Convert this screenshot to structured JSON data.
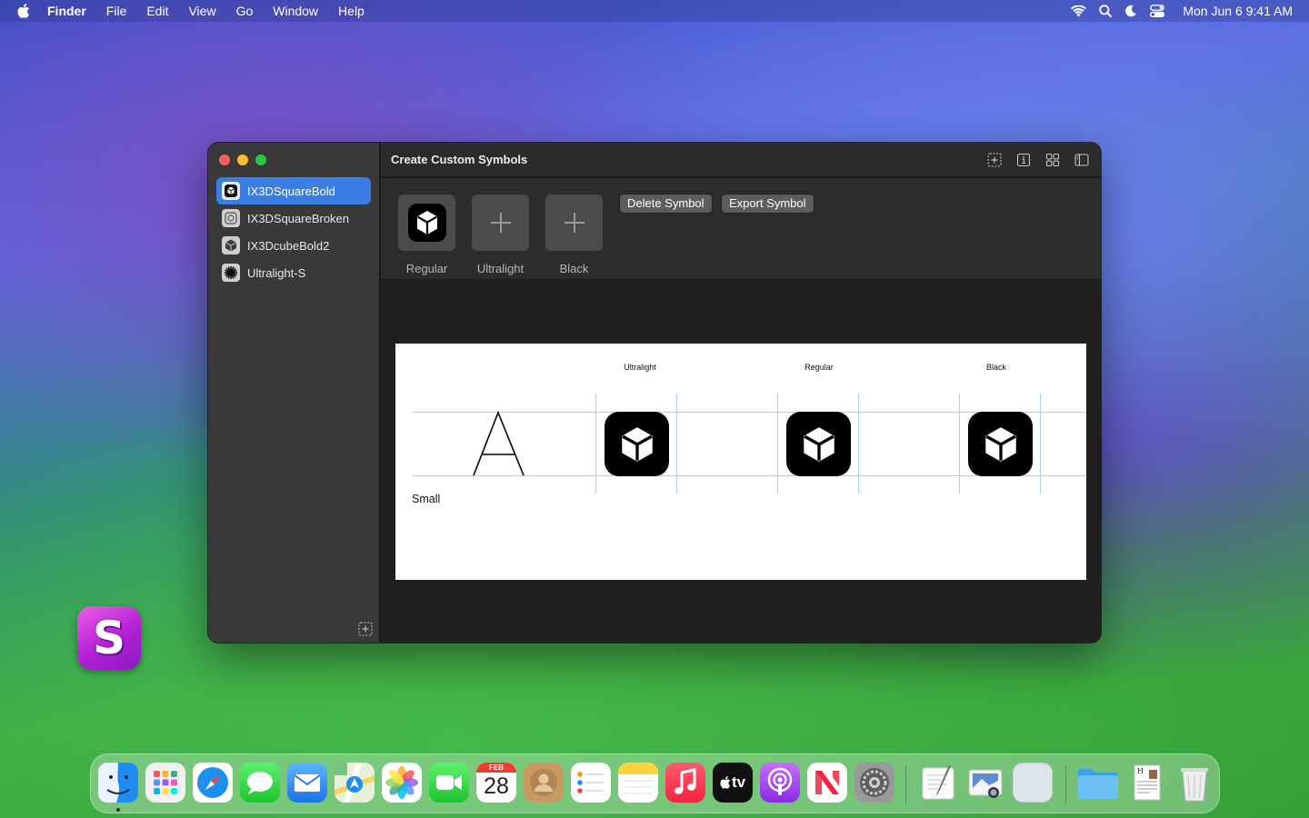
{
  "menubar": {
    "app_name": "Finder",
    "menus": [
      "File",
      "Edit",
      "View",
      "Go",
      "Window",
      "Help"
    ],
    "clock": "Mon Jun 6  9:41 AM",
    "status_icons": [
      "wifi-icon",
      "search-icon",
      "moon-icon",
      "control-center-icon"
    ]
  },
  "window": {
    "title": "Create Custom Symbols",
    "toolbar_icons": [
      "add-symbol-icon",
      "info-icon",
      "grid-view-icon",
      "sidebar-toggle-icon"
    ],
    "symbols": [
      {
        "name": "IX3DSquareBold",
        "selected": true
      },
      {
        "name": "IX3DSquareBroken",
        "selected": false
      },
      {
        "name": "IX3DcubeBold2",
        "selected": false
      },
      {
        "name": "Ultralight-S",
        "selected": false
      }
    ],
    "weights": [
      {
        "label": "Regular",
        "filled": true
      },
      {
        "label": "Ultralight",
        "filled": false
      },
      {
        "label": "Black",
        "filled": false
      }
    ],
    "buttons": {
      "delete": "Delete Symbol",
      "export": "Export Symbol"
    },
    "preview": {
      "columns": [
        "Ultralight",
        "Regular",
        "Black"
      ],
      "reference_glyph": "A",
      "size_label": "Small"
    }
  },
  "desktop": {
    "icon_letter": "S"
  },
  "dock": {
    "calendar_month": "FEB",
    "calendar_day": "28",
    "apps": [
      "Finder",
      "Launchpad",
      "Safari",
      "Messages",
      "Mail",
      "Maps",
      "Photos",
      "FaceTime",
      "Calendar",
      "Contacts",
      "Reminders",
      "Notes",
      "Music",
      "TV",
      "Podcasts",
      "News",
      "System Settings",
      "TextEdit",
      "Preview",
      "Blank App",
      "Downloads",
      "Document",
      "Trash"
    ],
    "tv_label": "tv"
  }
}
